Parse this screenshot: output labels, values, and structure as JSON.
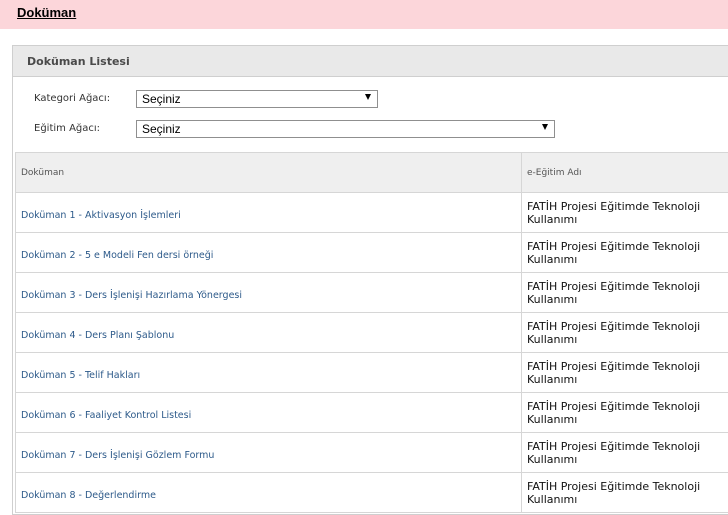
{
  "header": {
    "title": "Doküman"
  },
  "panel": {
    "title": "Doküman Listesi"
  },
  "filters": {
    "category_label": "Kategori Ağacı:",
    "category_value": "Seçiniz",
    "training_label": "Eğitim Ağacı:",
    "training_value": "Seçiniz"
  },
  "table": {
    "columns": [
      "Doküman",
      "e-Eğitim Adı"
    ],
    "rows": [
      {
        "document": "Doküman 1 - Aktivasyon İşlemleri",
        "course": "FATİH Projesi Eğitimde Teknoloji Kullanımı"
      },
      {
        "document": "Doküman 2 - 5 e Modeli Fen dersi örneği",
        "course": "FATİH Projesi Eğitimde Teknoloji Kullanımı"
      },
      {
        "document": "Doküman 3 - Ders İşlenişi Hazırlama Yönergesi",
        "course": "FATİH Projesi Eğitimde Teknoloji Kullanımı"
      },
      {
        "document": "Doküman 4 - Ders Planı Şablonu",
        "course": "FATİH Projesi Eğitimde Teknoloji Kullanımı"
      },
      {
        "document": "Doküman 5 - Telif Hakları",
        "course": "FATİH Projesi Eğitimde Teknoloji Kullanımı"
      },
      {
        "document": "Doküman 6 - Faaliyet Kontrol Listesi",
        "course": "FATİH Projesi Eğitimde Teknoloji Kullanımı"
      },
      {
        "document": "Doküman 7 - Ders İşlenişi Gözlem Formu",
        "course": "FATİH Projesi Eğitimde Teknoloji Kullanımı"
      },
      {
        "document": "Doküman 8 - Değerlendirme",
        "course": "FATİH Projesi Eğitimde Teknoloji Kullanımı"
      }
    ]
  },
  "colors": {
    "topbar_bg": "#fcd6da",
    "link": "#2d5a8a",
    "panel_header_bg": "#e9e9e9"
  }
}
